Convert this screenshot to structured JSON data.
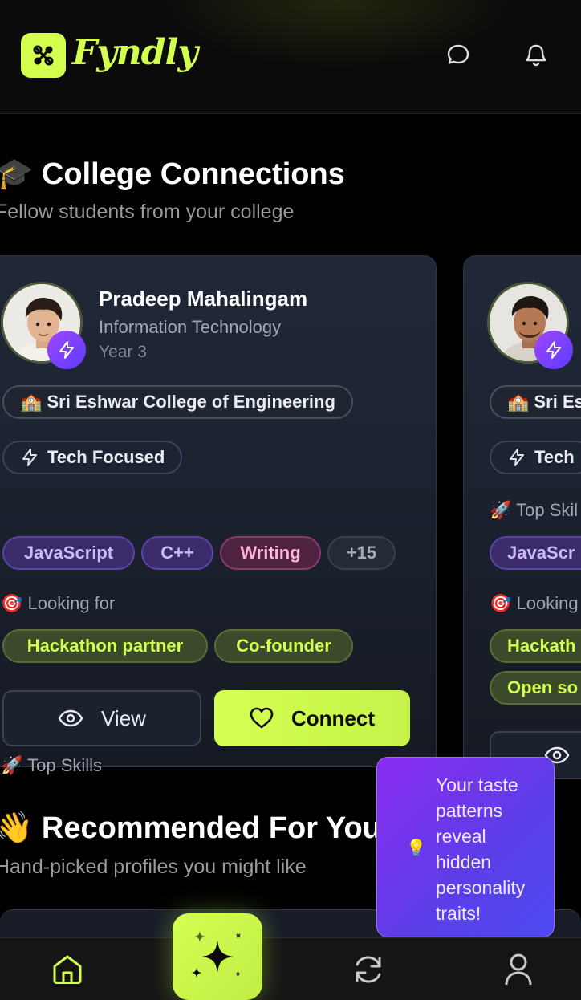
{
  "app": {
    "name": "Fyndly"
  },
  "colors": {
    "accent": "#d4ff4f",
    "purple": "#7a3cf0",
    "background": "#000000"
  },
  "header": {
    "chat_icon": "chat-bubble-icon",
    "bell_icon": "bell-icon"
  },
  "college_section": {
    "emoji": "🎓",
    "title": "College Connections",
    "subtitle": "Fellow students from your college"
  },
  "cards": [
    {
      "name": "Pradeep Mahalingam",
      "department": "Information Technology",
      "year": "Year 3",
      "college": "🏫 Sri Eshwar College of Engineering",
      "focus": "Tech Focused",
      "top_skills_label": "🚀 Top Skills",
      "skills": [
        "JavaScript",
        "C++",
        "Writing",
        "+15"
      ],
      "looking_for_label": "🎯 Looking for",
      "looking_for": [
        "Hackathon partner",
        "Co-founder"
      ],
      "view_label": "View",
      "connect_label": "Connect"
    },
    {
      "college": "🏫 Sri Es",
      "focus": "Tech",
      "top_skills_label": "🚀 Top Skil",
      "skills": [
        "JavaScr"
      ],
      "looking_for_label": "🎯 Looking",
      "looking_for": [
        "Hackath",
        "Open so"
      ]
    }
  ],
  "recommended_section": {
    "emoji": "👋",
    "title": "Recommended For You",
    "subtitle": "Hand-picked profiles you might like"
  },
  "tooltip": {
    "icon": "💡",
    "text": "Your taste patterns reveal hidden personality traits!"
  },
  "bottom_nav": {
    "items": [
      "home-icon",
      "sparkle-icon",
      "refresh-icon",
      "profile-icon"
    ],
    "active": "home-icon"
  }
}
